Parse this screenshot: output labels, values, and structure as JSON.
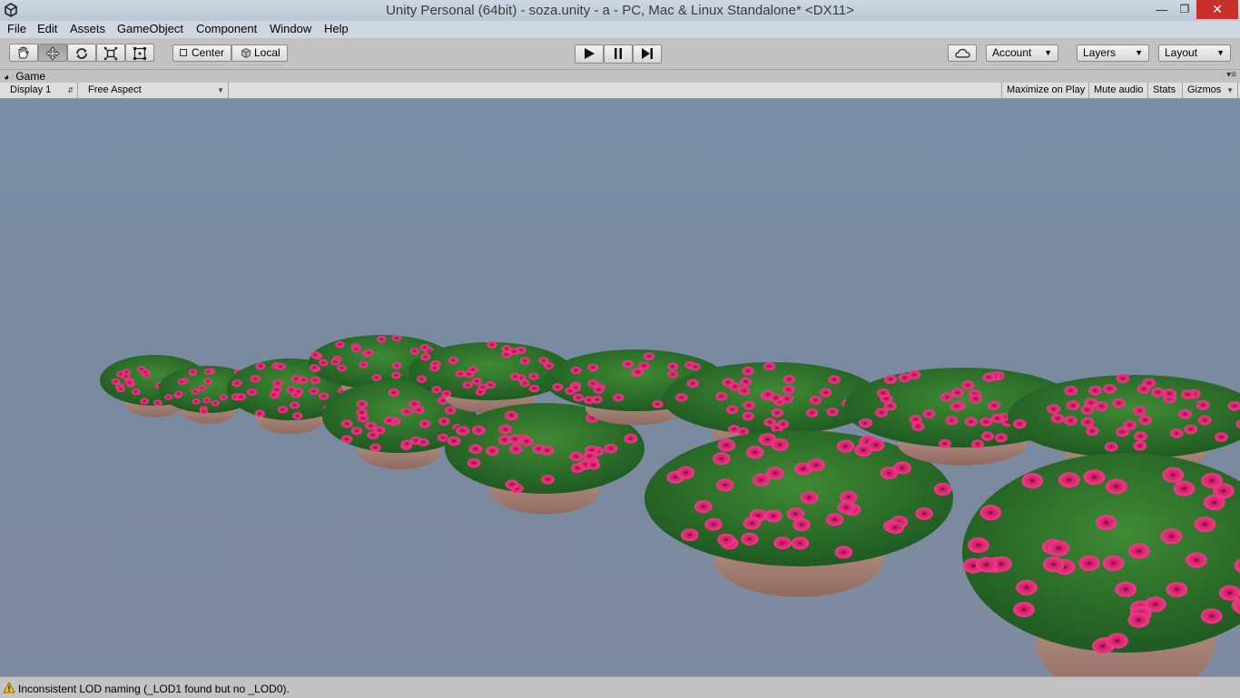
{
  "window": {
    "title": "Unity Personal (64bit) - soza.unity - a - PC, Mac & Linux Standalone* <DX11>"
  },
  "menu": [
    "File",
    "Edit",
    "Assets",
    "GameObject",
    "Component",
    "Window",
    "Help"
  ],
  "toolbar": {
    "tools": [
      "hand-tool",
      "move-tool",
      "rotate-tool",
      "scale-tool",
      "rect-tool"
    ],
    "active_tool": "move-tool",
    "pivot_label": "Center",
    "space_label": "Local",
    "play": [
      "play",
      "pause",
      "step"
    ],
    "account_label": "Account",
    "layers_label": "Layers",
    "layout_label": "Layout"
  },
  "game_panel": {
    "tab_label": "Game",
    "display": "Display 1",
    "aspect": "Free Aspect",
    "maximize_label": "Maximize on Play",
    "mute_label": "Mute audio",
    "stats_label": "Stats",
    "gizmos_label": "Gizmos"
  },
  "status": {
    "message": "Inconsistent LOD naming (_LOD1 found but no _LOD0)."
  },
  "colors": {
    "sky_top": "#7c8fa6",
    "sky_bottom": "#7f8ba0",
    "petal": "#e0287a",
    "leaf": "#2f7a2a",
    "pot": "#b88f84"
  }
}
